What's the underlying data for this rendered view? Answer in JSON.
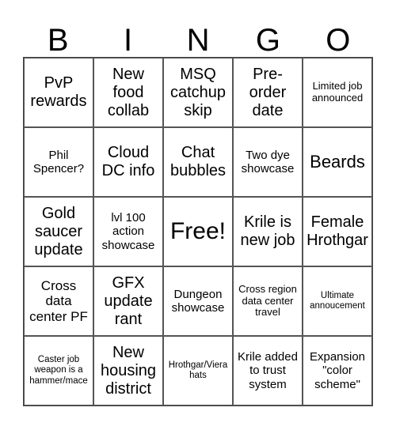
{
  "header": [
    "B",
    "I",
    "N",
    "G",
    "O"
  ],
  "cells": [
    "PvP rewards",
    "New food collab",
    "MSQ catchup skip",
    "Pre-order date",
    "Limited job announced",
    "Phil Spencer?",
    "Cloud DC info",
    "Chat bubbles",
    "Two dye showcase",
    "Beards",
    "Gold saucer update",
    "lvl 100 action showcase",
    "Free!",
    "Krile is new job",
    "Female Hrothgar",
    "Cross data center PF",
    "GFX update rant",
    "Dungeon showcase",
    "Cross region data center travel",
    "Ultimate annoucement",
    "Caster job weapon is a hammer/mace",
    "New housing district",
    "Hrothgar/Viera hats",
    "Krile added to trust system",
    "Expansion \"color scheme\""
  ]
}
